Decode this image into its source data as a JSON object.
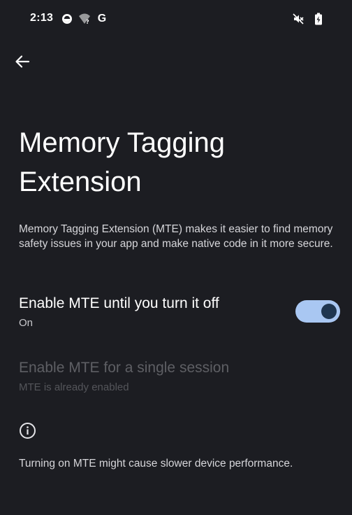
{
  "status_bar": {
    "time": "2:13",
    "icons": [
      "notification-icon",
      "wifi-unknown-icon",
      "google-g-icon",
      "mute-icon",
      "battery-charging-icon"
    ],
    "google_letter": "G"
  },
  "app_bar": {
    "back_icon": "arrow-back-icon"
  },
  "page": {
    "title": "Memory Tagging Extension",
    "description": "Memory Tagging Extension (MTE) makes it easier to find memory safety issues in your app and make native code in it more secure."
  },
  "settings": {
    "enable_until_off": {
      "title": "Enable MTE until you turn it off",
      "summary": "On",
      "toggle_on": true
    },
    "enable_single_session": {
      "title": "Enable MTE for a single session",
      "summary": "MTE is already enabled",
      "enabled": false
    }
  },
  "footer": {
    "info_icon": "info-icon",
    "text": "Turning on MTE might cause slower device performance."
  },
  "colors": {
    "background": "#1c1d22",
    "toggle_track": "#a9c7f2",
    "toggle_thumb": "#1f3650",
    "text_primary": "#ffffff",
    "text_disabled": "#5e5f64"
  }
}
